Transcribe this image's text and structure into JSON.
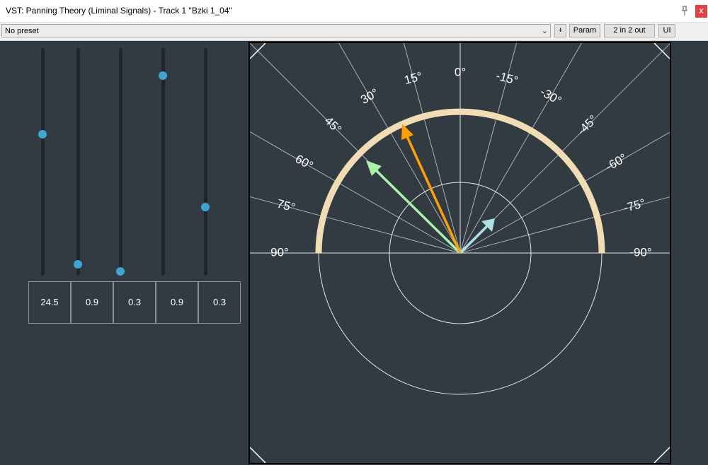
{
  "window": {
    "title": "VST: Panning Theory (Liminal Signals) - Track 1 \"Bzki 1_04\"",
    "close_label": "x"
  },
  "toolbar": {
    "preset": "No preset",
    "add_label": "+",
    "param_label": "Param",
    "io_label": "2 in 2 out",
    "ui_label": "UI",
    "enabled_check": "✓"
  },
  "sliders": [
    {
      "name": "slider-1",
      "value": "24.5",
      "level": 0.62
    },
    {
      "name": "slider-2",
      "value": "0.9",
      "level": 0.05
    },
    {
      "name": "slider-3",
      "value": "0.3",
      "level": 0.02
    },
    {
      "name": "slider-4",
      "value": "0.9",
      "level": 0.88
    },
    {
      "name": "slider-5",
      "value": "0.3",
      "level": 0.3
    }
  ],
  "panner": {
    "angle_labels_left": [
      "90°",
      "75°",
      "60°",
      "45°",
      "30°",
      "15°"
    ],
    "center_label": "0°",
    "angle_labels_right": [
      "-15°",
      "-30°",
      "-45°",
      "-60°",
      "-75°",
      "-90°"
    ],
    "arc_color": "#f1dcb4",
    "arrows": [
      {
        "name": "orange-arrow",
        "color": "#ffa100"
      },
      {
        "name": "green-arrow",
        "color": "#a9f2a9"
      },
      {
        "name": "cyan-arrow",
        "color": "#aee0e6"
      }
    ]
  }
}
